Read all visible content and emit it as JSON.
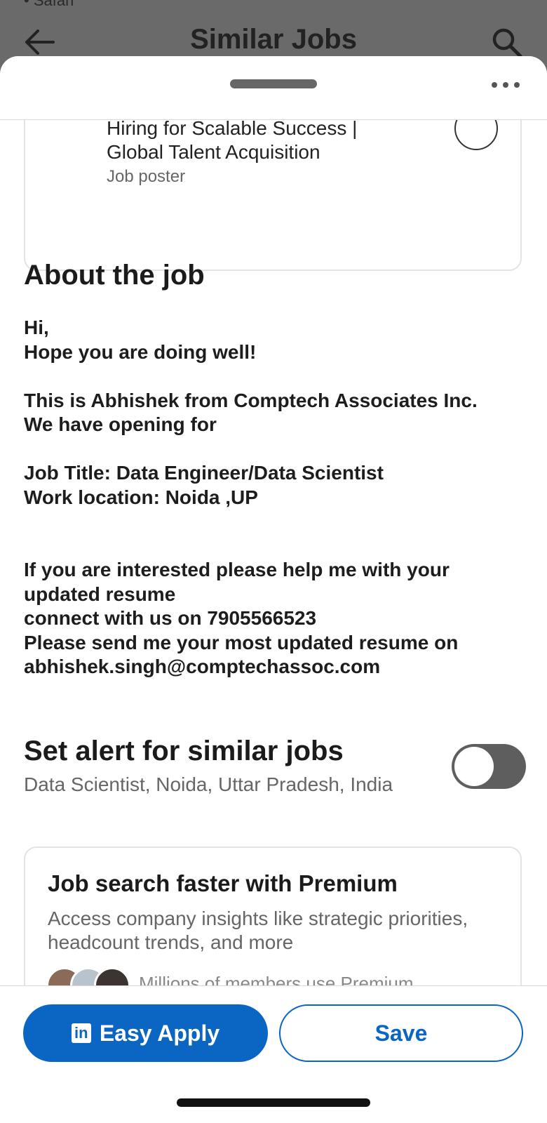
{
  "background_header": {
    "status_text": "• Safari",
    "title": "Similar Jobs"
  },
  "poster": {
    "headline": "Hiring for Scalable Success | Global Talent Acquisition",
    "role": "Job poster"
  },
  "about": {
    "title": "About the job",
    "lines": [
      "Hi,",
      "Hope you are doing well!",
      "",
      "This is Abhishek from Comptech Associates Inc.",
      "We have opening for",
      "",
      "Job Title: Data Engineer/Data Scientist",
      "Work location: Noida ,UP",
      "",
      "",
      "If you are interested please help me with your",
      "updated resume",
      "connect with us on 7905566523",
      "Please send me your most updated resume on",
      "abhishek.singh@comptechassoc.com"
    ]
  },
  "alert": {
    "title": "Set alert for similar jobs",
    "subtitle": "Data Scientist, Noida, Uttar Pradesh, India",
    "enabled": false
  },
  "premium": {
    "title": "Job search faster with Premium",
    "description": "Access company insights like strategic priorities, headcount trends, and more",
    "members_text": "Millions of members use Premium"
  },
  "actions": {
    "apply_label": "Easy Apply",
    "save_label": "Save"
  },
  "colors": {
    "brand_blue": "#0a66c2",
    "toggle_off": "#5e5e5e"
  }
}
